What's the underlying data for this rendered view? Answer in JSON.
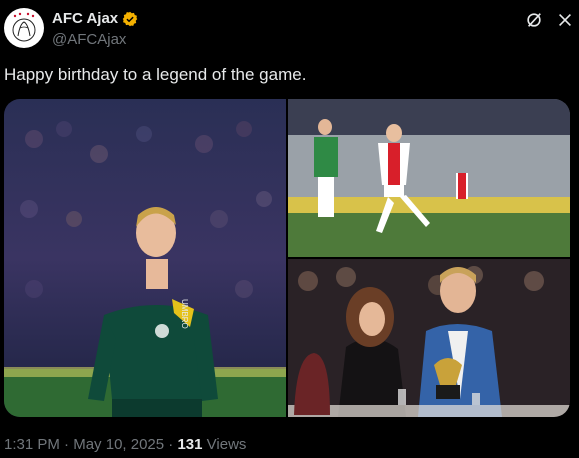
{
  "account": {
    "name": "AFC Ajax",
    "handle": "@AFCAjax",
    "verified_color": "#f5b100"
  },
  "tweet": {
    "text": "Happy birthday to a legend of the game."
  },
  "media": {
    "photos": [
      {
        "id": "main",
        "description": "player in green and yellow jersey"
      },
      {
        "id": "top-right",
        "description": "match action shot"
      },
      {
        "id": "bottom-right",
        "description": "award ceremony with trophy"
      }
    ],
    "jersey_text": "UMBRO"
  },
  "meta": {
    "time": "1:31 PM",
    "separator": "·",
    "date": "May 10, 2025",
    "views_count": "131",
    "views_label": "Views"
  },
  "colors": {
    "background": "#000000",
    "text_primary": "#e7e9ea",
    "text_secondary": "#71767b"
  },
  "icons": {
    "grok": "grok-icon",
    "more": "more-icon"
  }
}
